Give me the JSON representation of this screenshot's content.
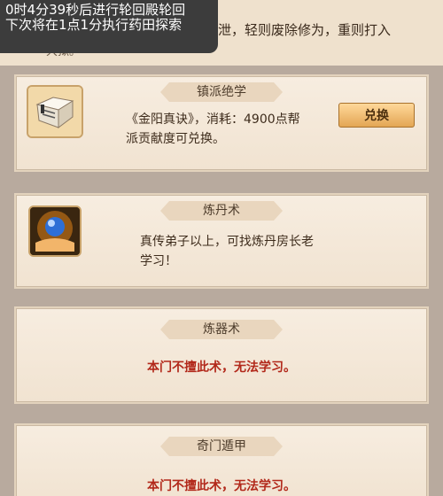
{
  "overlay": {
    "line1": "0时4分39秒后进行轮回殿轮回",
    "line2": "下次将在1点1分执行药田探索"
  },
  "top": {
    "line1": "泄，轻则废除修为，重则打入",
    "line2": "大狱。"
  },
  "cards": [
    {
      "title": "镇派绝学",
      "desc_line1": "《金阳真诀》，消耗：4900点帮",
      "desc_line2": "派贡献度可兑换。",
      "button": "兑换",
      "icon": "scroll-book-icon"
    },
    {
      "title": "炼丹术",
      "desc_line1": "真传弟子以上，可找炼丹房长老",
      "desc_line2": "学习！",
      "icon": "orb-hand-icon"
    },
    {
      "title": "炼器术",
      "warning": "本门不擅此术，无法学习。"
    },
    {
      "title": "奇门遁甲",
      "warning": "本门不擅此术，无法学习。"
    }
  ],
  "colors": {
    "warning": "#b2281a",
    "button": "#e3a654",
    "background": "#b8aa9e"
  }
}
